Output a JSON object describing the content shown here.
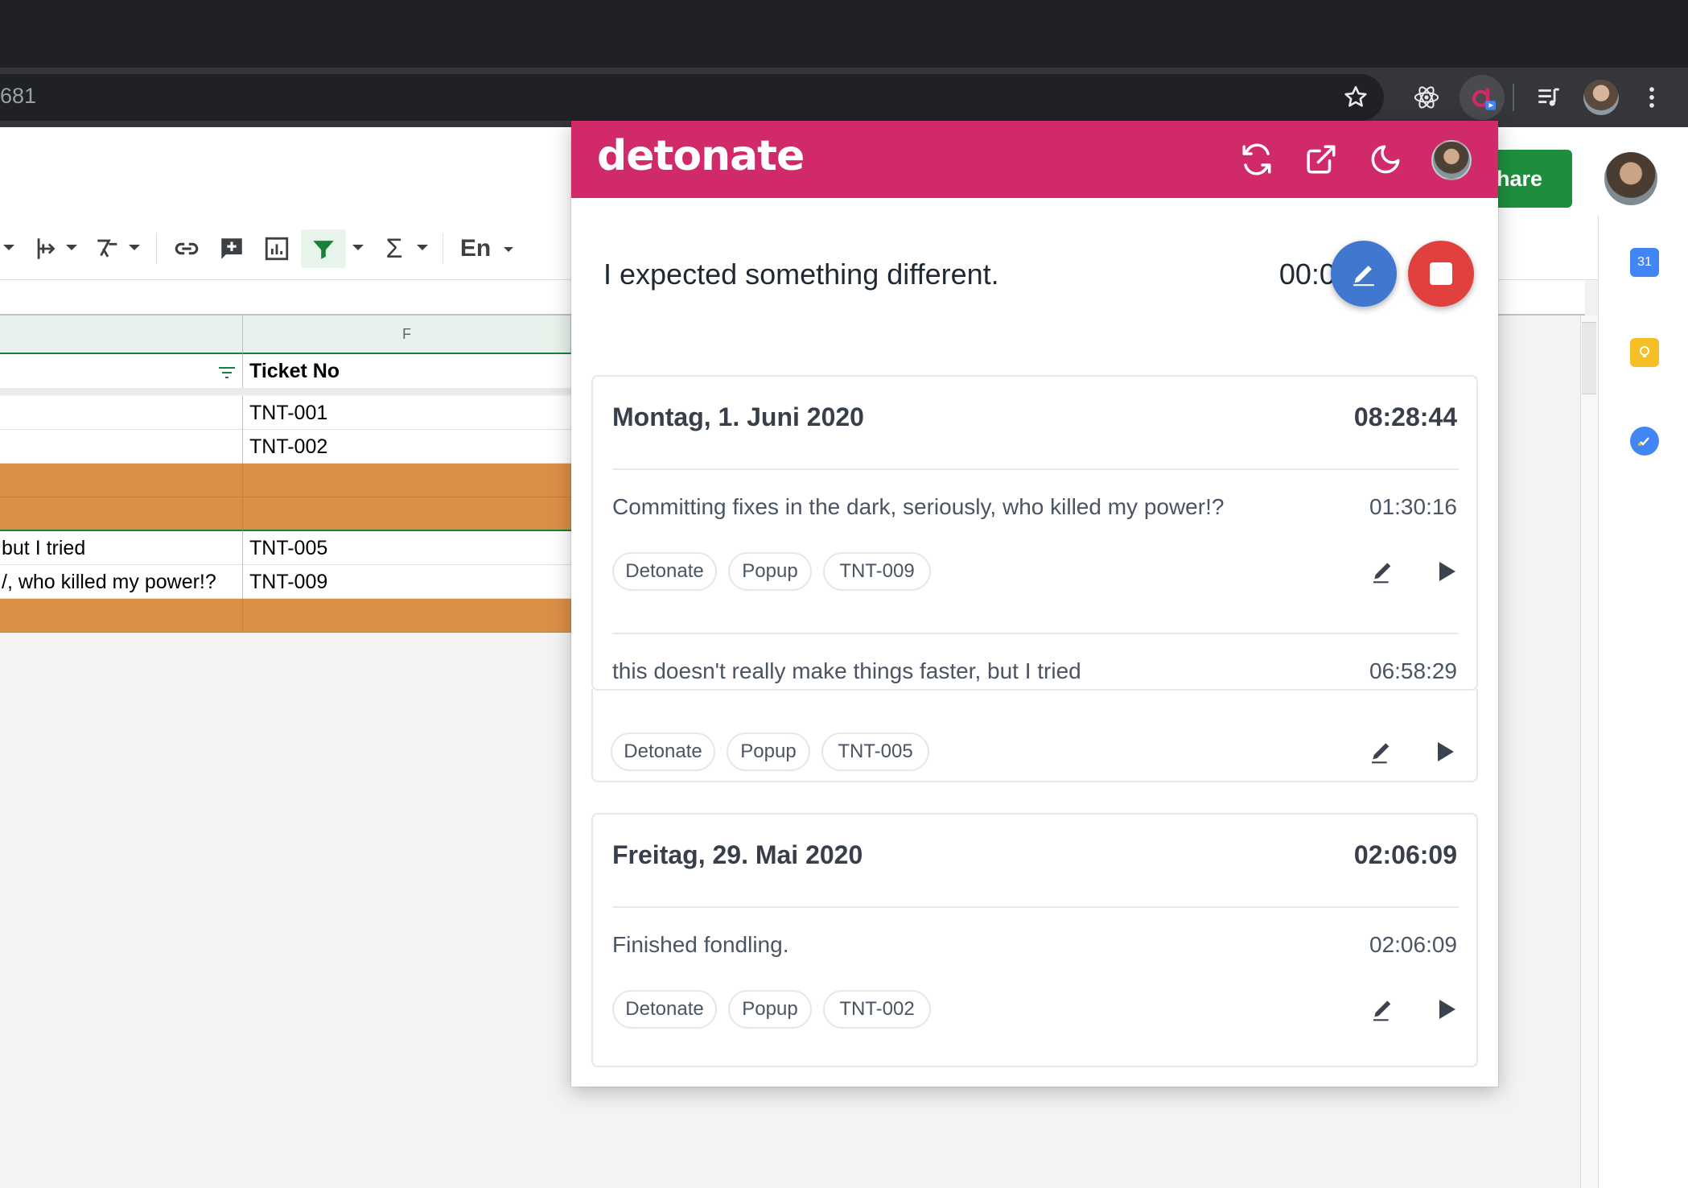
{
  "browser": {
    "url_fragment": "681",
    "icons": [
      "star-icon",
      "react-devtools-icon",
      "detonate-extension-icon",
      "media-queue-icon",
      "profile-avatar",
      "more-vert-icon"
    ]
  },
  "sheets": {
    "share_label": "hare",
    "toolbar": {
      "language_label": "En"
    },
    "column_header": "F",
    "header_row": {
      "e": "",
      "f": "Ticket No"
    },
    "rows": [
      {
        "e": "",
        "f": "TNT-001",
        "style": "white"
      },
      {
        "e": "",
        "f": "TNT-002",
        "style": "white"
      },
      {
        "e": "",
        "f": "",
        "style": "orange"
      },
      {
        "e": "",
        "f": "",
        "style": "orange"
      },
      {
        "e": " but I tried",
        "f": "TNT-005",
        "style": "white"
      },
      {
        "e": "/, who killed my power!?",
        "f": "TNT-009",
        "style": "white"
      },
      {
        "e": "",
        "f": "",
        "style": "orange"
      }
    ],
    "side_panel": {
      "calendar_label": "31"
    }
  },
  "popup": {
    "brand": "detonate",
    "brand_color": "#d12a6a",
    "header_actions": [
      "refresh-icon",
      "open-external-icon",
      "dark-mode-icon",
      "user-avatar"
    ],
    "current": {
      "description": "I expected something different.",
      "elapsed": "00:07:15"
    },
    "days": [
      {
        "date": "Montag, 1. Juni 2020",
        "total": "08:28:44",
        "entries": [
          {
            "description": "Committing fixes in the dark, seriously, who killed my power!?",
            "duration": "01:30:16",
            "tags": [
              "Detonate",
              "Popup",
              "TNT-009"
            ]
          },
          {
            "description": "this doesn't really make things faster, but I tried",
            "duration": "06:58:29",
            "tags": [
              "Detonate",
              "Popup",
              "TNT-005"
            ]
          }
        ]
      },
      {
        "date": "Freitag, 29. Mai 2020",
        "total": "02:06:09",
        "entries": [
          {
            "description": "Finished fondling.",
            "duration": "02:06:09",
            "tags": [
              "Detonate",
              "Popup",
              "TNT-002"
            ]
          }
        ]
      }
    ]
  }
}
